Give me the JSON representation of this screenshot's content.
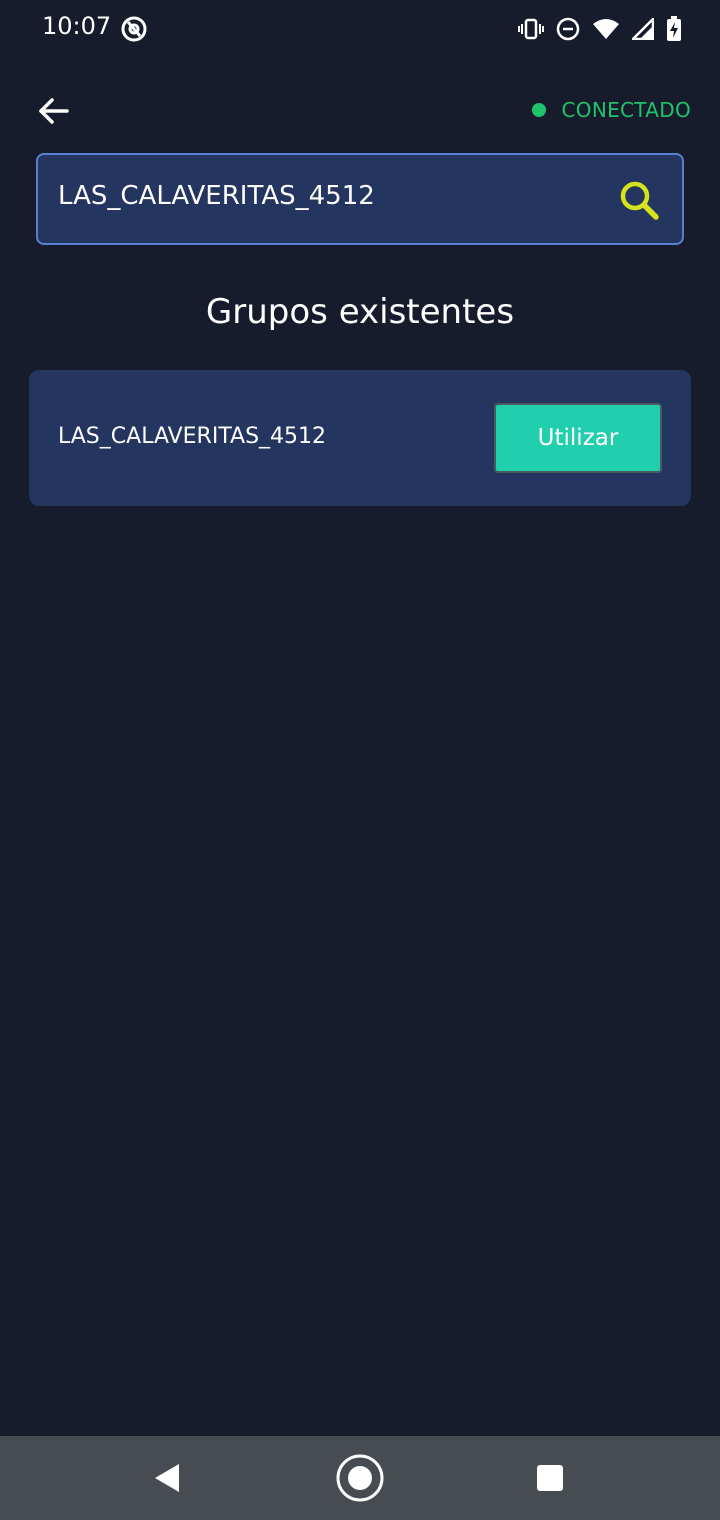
{
  "status_bar": {
    "time": "10:07",
    "icons": [
      "at-sign-icon",
      "vibrate-icon",
      "do-not-disturb-icon",
      "wifi-icon",
      "signal-icon",
      "battery-charging-icon"
    ]
  },
  "header": {
    "back_icon": "arrow-left-icon",
    "connection_status": "CONECTADO",
    "connection_color": "#1fc36b"
  },
  "search": {
    "value": "LAS_CALAVERITAS_4512",
    "icon": "search-icon",
    "icon_color": "#d7e31a"
  },
  "section": {
    "title": "Grupos existentes"
  },
  "groups": [
    {
      "name": "LAS_CALAVERITAS_4512",
      "action_label": "Utilizar"
    }
  ],
  "nav_bar": {
    "items": [
      "back-triangle-icon",
      "home-circle-icon",
      "recents-square-icon"
    ]
  },
  "colors": {
    "background": "#171c2c",
    "card": "#243560",
    "accent": "#21cfae"
  }
}
